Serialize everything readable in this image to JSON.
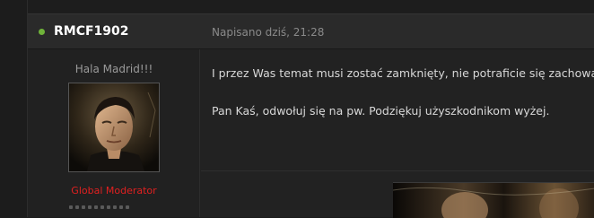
{
  "post": {
    "author": {
      "username": "RMCF1902",
      "online": true,
      "status_color": "#6fb33a",
      "user_title": "Hala Madrid!!!",
      "rank": "Global Moderator",
      "rank_color": "#e02020",
      "reputation_pips": 10
    },
    "date": "Napisano dziś, 21:28",
    "body": [
      "I przez Was temat musi zostać zamknięty, nie potraficie się zachować.",
      "Pan Kaś, odwołuj się na pw. Podziękuj użyszkodnikom wyżej."
    ]
  }
}
